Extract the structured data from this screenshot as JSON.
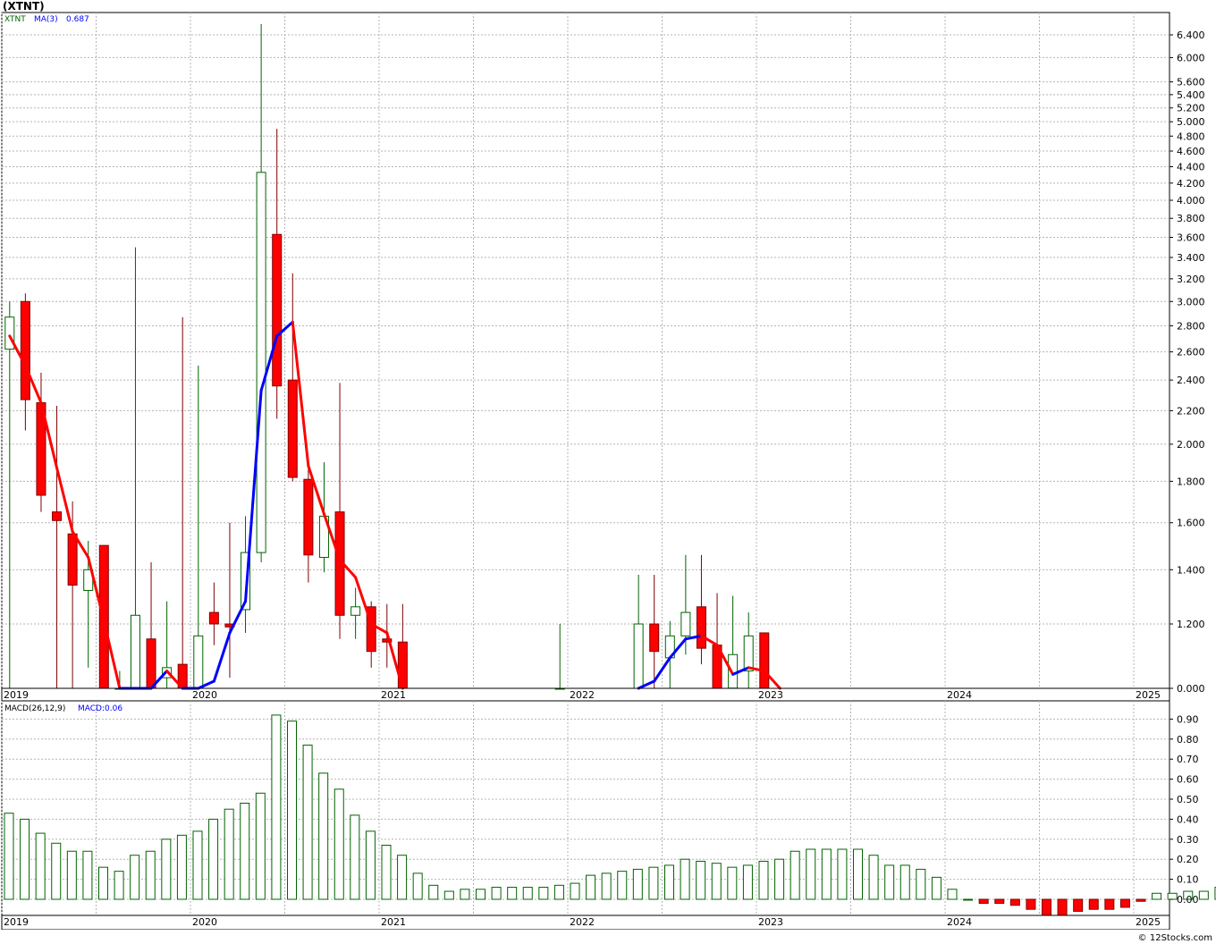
{
  "title": "(XTNT)",
  "footer": "© 12Stocks.com",
  "legend_price": {
    "ticker": "XTNT",
    "ma_label": "MA(3)",
    "ma_value": "0.687"
  },
  "legend_macd": {
    "label": "MACD(26,12,9)",
    "value_label": "MACD:0.06"
  },
  "colors": {
    "up": "#006400",
    "down": "#ff0000",
    "ma": "#0000ff",
    "ma_down": "#ff0000",
    "grid": "#b4b4b4",
    "axis": "#000000"
  },
  "chart_data": [
    {
      "type": "candlestick",
      "title": "",
      "x_labels": [
        "2019",
        "2020",
        "2021",
        "2022",
        "2023",
        "2024",
        "2025"
      ],
      "y_ticks": [
        "0.000",
        "1.200",
        "1.400",
        "1.600",
        "1.800",
        "2.000",
        "2.200",
        "2.400",
        "2.600",
        "2.800",
        "3.000",
        "3.200",
        "3.400",
        "3.600",
        "3.800",
        "4.000",
        "4.200",
        "4.400",
        "4.600",
        "4.800",
        "5.000",
        "5.200",
        "5.400",
        "5.600",
        "6.000",
        "6.400"
      ],
      "y_scale": "log",
      "grid": true,
      "candles": [
        {
          "date": "2019-01",
          "o": 2.62,
          "h": 3.0,
          "l": 0.9,
          "c": 2.87
        },
        {
          "date": "2019-02",
          "o": 3.0,
          "h": 3.07,
          "l": 2.08,
          "c": 2.27
        },
        {
          "date": "2019-03",
          "o": 2.25,
          "h": 2.45,
          "l": 1.65,
          "c": 1.73
        },
        {
          "date": "2019-04",
          "o": 1.65,
          "h": 2.23,
          "l": 0.9,
          "c": 1.61
        },
        {
          "date": "2019-05",
          "o": 1.55,
          "h": 1.7,
          "l": 0.9,
          "c": 1.34
        },
        {
          "date": "2019-06",
          "o": 1.32,
          "h": 1.52,
          "l": 1.06,
          "c": 1.4
        },
        {
          "date": "2019-07",
          "o": 1.5,
          "h": 1.5,
          "l": 0.9,
          "c": 0.9
        },
        {
          "date": "2019-08",
          "o": 0.9,
          "h": 1.05,
          "l": 0.9,
          "c": 0.9
        },
        {
          "date": "2019-09",
          "o": 0.9,
          "h": 3.5,
          "l": 0.9,
          "c": 1.23
        },
        {
          "date": "2019-10",
          "o": 1.15,
          "h": 1.43,
          "l": 0.9,
          "c": 0.9
        },
        {
          "date": "2019-11",
          "o": 1.03,
          "h": 1.28,
          "l": 0.9,
          "c": 1.06
        },
        {
          "date": "2019-12",
          "o": 1.07,
          "h": 2.87,
          "l": 0.9,
          "c": 0.9
        },
        {
          "date": "2020-01",
          "o": 0.9,
          "h": 2.5,
          "l": 0.9,
          "c": 1.16
        },
        {
          "date": "2020-02",
          "o": 1.24,
          "h": 1.35,
          "l": 1.13,
          "c": 1.2
        },
        {
          "date": "2020-03",
          "o": 1.2,
          "h": 1.6,
          "l": 1.03,
          "c": 1.19
        },
        {
          "date": "2020-04",
          "o": 1.25,
          "h": 1.63,
          "l": 1.17,
          "c": 1.47
        },
        {
          "date": "2020-05",
          "o": 1.47,
          "h": 6.6,
          "l": 1.43,
          "c": 4.33
        },
        {
          "date": "2020-06",
          "o": 3.63,
          "h": 4.9,
          "l": 2.15,
          "c": 2.36
        },
        {
          "date": "2020-07",
          "o": 2.4,
          "h": 3.25,
          "l": 1.8,
          "c": 1.82
        },
        {
          "date": "2020-08",
          "o": 1.81,
          "h": 1.88,
          "l": 1.35,
          "c": 1.46
        },
        {
          "date": "2020-09",
          "o": 1.45,
          "h": 1.9,
          "l": 1.39,
          "c": 1.63
        },
        {
          "date": "2020-10",
          "o": 1.65,
          "h": 2.38,
          "l": 1.15,
          "c": 1.23
        },
        {
          "date": "2020-11",
          "o": 1.23,
          "h": 1.33,
          "l": 1.15,
          "c": 1.26
        },
        {
          "date": "2020-12",
          "o": 1.26,
          "h": 1.28,
          "l": 1.06,
          "c": 1.11
        },
        {
          "date": "2021-01",
          "o": 1.15,
          "h": 1.27,
          "l": 1.06,
          "c": 1.14
        },
        {
          "date": "2021-02",
          "o": 1.14,
          "h": 1.27,
          "l": 0.9,
          "c": 0.9
        },
        {
          "date": "2021-12",
          "o": 0.9,
          "h": 1.2,
          "l": 0.9,
          "c": 0.9
        },
        {
          "date": "2022-05",
          "o": 0.9,
          "h": 1.38,
          "l": 0.9,
          "c": 1.2
        },
        {
          "date": "2022-06",
          "o": 1.2,
          "h": 1.38,
          "l": 0.9,
          "c": 1.11
        },
        {
          "date": "2022-07",
          "o": 1.09,
          "h": 1.21,
          "l": 0.9,
          "c": 1.16
        },
        {
          "date": "2022-08",
          "o": 1.16,
          "h": 1.46,
          "l": 1.1,
          "c": 1.24
        },
        {
          "date": "2022-09",
          "o": 1.26,
          "h": 1.46,
          "l": 1.07,
          "c": 1.12
        },
        {
          "date": "2022-10",
          "o": 1.13,
          "h": 1.31,
          "l": 0.9,
          "c": 0.9
        },
        {
          "date": "2022-11",
          "o": 1.0,
          "h": 1.3,
          "l": 0.9,
          "c": 1.1
        },
        {
          "date": "2022-12",
          "o": 1.05,
          "h": 1.24,
          "l": 0.9,
          "c": 1.16
        },
        {
          "date": "2023-01",
          "o": 1.17,
          "h": 1.17,
          "l": 0.9,
          "c": 0.9
        }
      ],
      "ma": [
        {
          "date": "2019-01",
          "v": 2.72
        },
        {
          "date": "2019-02",
          "v": 2.5
        },
        {
          "date": "2019-03",
          "v": 2.25
        },
        {
          "date": "2019-04",
          "v": 1.87
        },
        {
          "date": "2019-05",
          "v": 1.56
        },
        {
          "date": "2019-06",
          "v": 1.45
        },
        {
          "date": "2019-07",
          "v": 1.21
        },
        {
          "date": "2019-08",
          "v": 0.9
        },
        {
          "date": "2019-10",
          "v": 0.9
        },
        {
          "date": "2019-11",
          "v": 1.05
        },
        {
          "date": "2019-12",
          "v": 0.9
        },
        {
          "date": "2020-01",
          "v": 0.9
        },
        {
          "date": "2020-02",
          "v": 1.02
        },
        {
          "date": "2020-03",
          "v": 1.17
        },
        {
          "date": "2020-04",
          "v": 1.28
        },
        {
          "date": "2020-05",
          "v": 2.33
        },
        {
          "date": "2020-06",
          "v": 2.72
        },
        {
          "date": "2020-07",
          "v": 2.83
        },
        {
          "date": "2020-08",
          "v": 1.88
        },
        {
          "date": "2020-09",
          "v": 1.64
        },
        {
          "date": "2020-10",
          "v": 1.44
        },
        {
          "date": "2020-11",
          "v": 1.37
        },
        {
          "date": "2020-12",
          "v": 1.2
        },
        {
          "date": "2021-01",
          "v": 1.17
        },
        {
          "date": "2021-02",
          "v": 0.9
        },
        {
          "date": "2022-05",
          "v": 0.9
        },
        {
          "date": "2022-06",
          "v": 1.02
        },
        {
          "date": "2022-07",
          "v": 1.09
        },
        {
          "date": "2022-08",
          "v": 1.15
        },
        {
          "date": "2022-09",
          "v": 1.16
        },
        {
          "date": "2022-10",
          "v": 1.13
        },
        {
          "date": "2022-11",
          "v": 1.04
        },
        {
          "date": "2022-12",
          "v": 1.06
        },
        {
          "date": "2023-01",
          "v": 1.05
        },
        {
          "date": "2023-02",
          "v": 0.9
        }
      ]
    },
    {
      "type": "bar",
      "title": "",
      "x_labels": [
        "2019",
        "2020",
        "2021",
        "2022",
        "2023",
        "2024",
        "2025"
      ],
      "y_ticks": [
        "0.00",
        "0.10",
        "0.20",
        "0.30",
        "0.40",
        "0.50",
        "0.60",
        "0.70",
        "0.80",
        "0.90"
      ],
      "ylim": [
        -0.08,
        0.95
      ],
      "grid": true,
      "values": [
        0.43,
        0.4,
        0.33,
        0.28,
        0.24,
        0.24,
        0.16,
        0.14,
        0.22,
        0.24,
        0.3,
        0.32,
        0.34,
        0.4,
        0.45,
        0.48,
        0.53,
        0.92,
        0.89,
        0.77,
        0.63,
        0.55,
        0.42,
        0.34,
        0.27,
        0.22,
        0.13,
        0.07,
        0.04,
        0.05,
        0.05,
        0.06,
        0.06,
        0.06,
        0.06,
        0.07,
        0.08,
        0.12,
        0.13,
        0.14,
        0.15,
        0.16,
        0.17,
        0.2,
        0.19,
        0.18,
        0.16,
        0.17,
        0.19,
        0.2,
        0.24,
        0.25,
        0.25,
        0.25,
        0.25,
        0.22,
        0.17,
        0.17,
        0.15,
        0.11,
        0.05,
        0.0,
        -0.02,
        -0.02,
        -0.03,
        -0.05,
        -0.08,
        -0.08,
        -0.06,
        -0.05,
        -0.05,
        -0.04,
        -0.01,
        0.03,
        0.03,
        0.04,
        0.04,
        0.06
      ]
    }
  ]
}
